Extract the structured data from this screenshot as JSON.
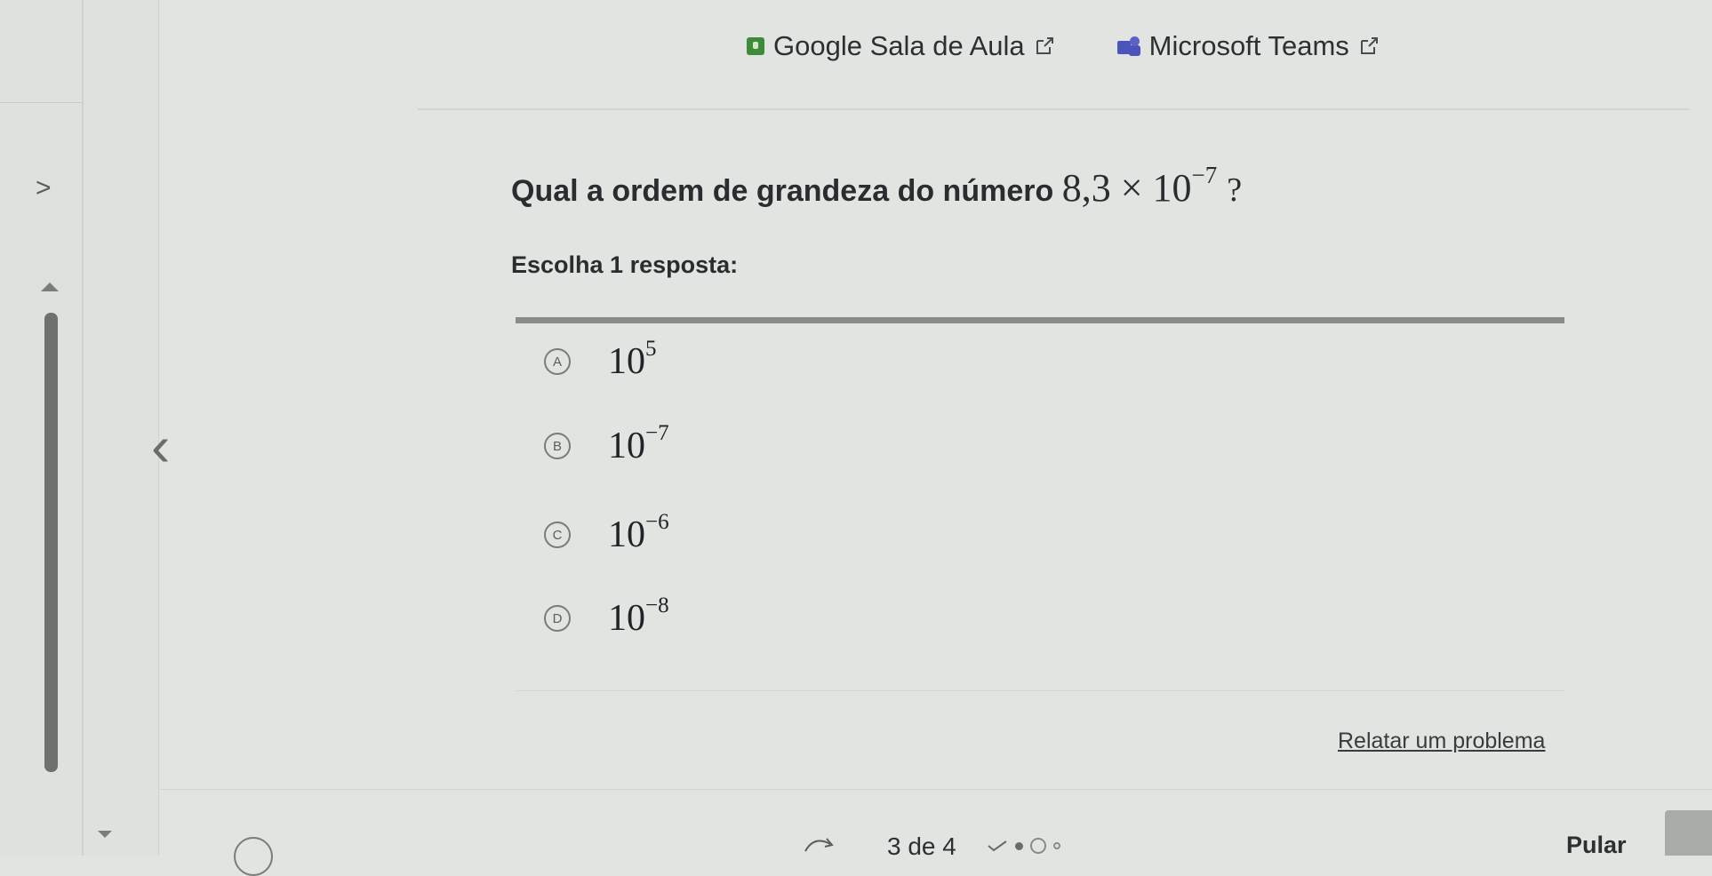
{
  "header_links": [
    {
      "label": "Google Sala de Aula",
      "icon": "google-classroom-icon"
    },
    {
      "label": "Microsoft Teams",
      "icon": "microsoft-teams-icon"
    }
  ],
  "question": {
    "prompt": "Qual a ordem de grandeza do número",
    "expression": {
      "mantissa": "8,3",
      "operator": "×",
      "base": "10",
      "exponent": "−7"
    },
    "suffix": "?",
    "instruction": "Escolha 1 resposta:"
  },
  "options": [
    {
      "letter": "A",
      "base": "10",
      "exponent": "5"
    },
    {
      "letter": "B",
      "base": "10",
      "exponent": "−7"
    },
    {
      "letter": "C",
      "base": "10",
      "exponent": "−6"
    },
    {
      "letter": "D",
      "base": "10",
      "exponent": "−8"
    }
  ],
  "report_link": "Relatar um problema",
  "footer": {
    "progress_label": "3 de 4",
    "skip_label": "Pular"
  },
  "colors": {
    "background": "#e2e4e1",
    "scrollbar": "#6f716e",
    "classroom_green": "#3f8b3c",
    "teams_purple": "#4b53bc"
  }
}
